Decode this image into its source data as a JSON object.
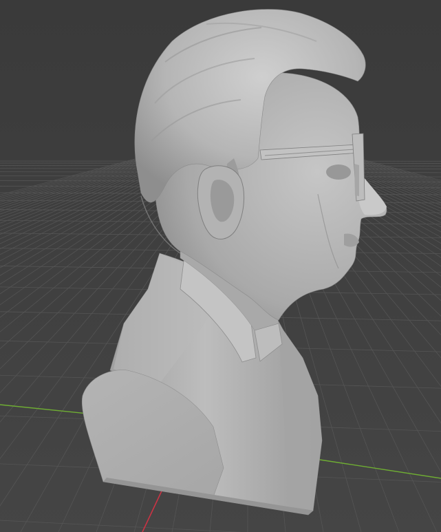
{
  "viewport": {
    "type": "3d-viewport",
    "background_color": "#3d3d3d",
    "grid_color": "#555555",
    "x_axis_color": "#cc3344",
    "y_axis_color": "#7bbd3a",
    "model_color": "#b7b7b7"
  },
  "model": {
    "subject": "sculpted bust",
    "features": [
      "head-with-hair",
      "ear",
      "glasses",
      "shirt-collar",
      "torso-base"
    ]
  }
}
